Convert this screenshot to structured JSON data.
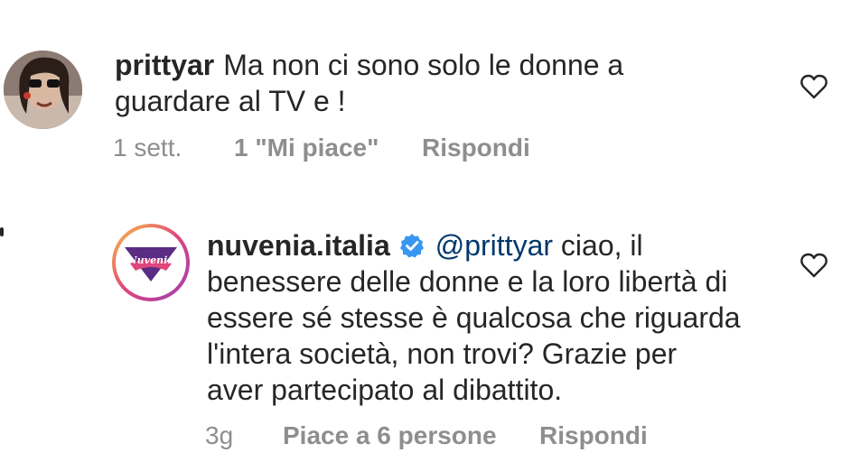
{
  "comments": [
    {
      "username": "prittyar",
      "text": "Ma non ci sono solo le donne a guardare al TV e !",
      "line1": "Ma non ci sono solo le donne a",
      "line2": "guardare al TV e !",
      "time": "1 sett.",
      "likes": "1 \"Mi piace\"",
      "reply_label": "Rispondi",
      "like_icon": "heart-outline-icon"
    },
    {
      "username": "nuvenia.italia",
      "verified": true,
      "mention": "@prittyar",
      "line1_rest": " ciao, il",
      "line2": "benessere delle donne e la loro libertà di",
      "line3": "essere sé stesse è qualcosa che riguarda",
      "line4": "l'intera società, non trovi? Grazie per",
      "line5": "aver partecipato al dibattito.",
      "time": "3g",
      "likes": "Piace a 6 persone",
      "reply_label": "Rispondi",
      "avatar_logo_text": "Nuvenia",
      "like_icon": "heart-outline-icon"
    }
  ],
  "colors": {
    "text": "#262626",
    "meta": "#8e8e8e",
    "mention": "#00376b",
    "verified": "#3897f0",
    "brand_purple": "#5b2c83",
    "brand_pink": "#e0457b"
  }
}
